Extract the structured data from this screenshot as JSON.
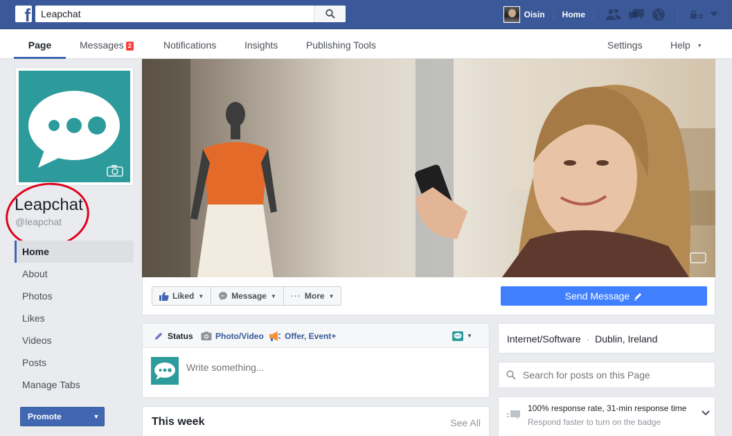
{
  "topbar": {
    "logo_glyph": "f",
    "search_value": "Leapchat",
    "user_name": "Oisin",
    "home_label": "Home",
    "icons": [
      "friends-icon",
      "messages-icon",
      "globe-icon",
      "lock-icon",
      "caret-down-icon"
    ]
  },
  "pagenav": {
    "tabs": [
      {
        "label": "Page",
        "active": true
      },
      {
        "label": "Messages",
        "badge": "2"
      },
      {
        "label": "Notifications"
      },
      {
        "label": "Insights"
      },
      {
        "label": "Publishing Tools"
      }
    ],
    "settings_label": "Settings",
    "help_label": "Help",
    "help_caret": "▼"
  },
  "page": {
    "name": "Leapchat",
    "handle": "@leapchat",
    "brand_color": "#2d9b9b"
  },
  "sidenav": {
    "items": [
      "Home",
      "About",
      "Photos",
      "Likes",
      "Videos",
      "Posts",
      "Manage Tabs"
    ],
    "active": "Home"
  },
  "promote": {
    "label": "Promote",
    "caret": "▼"
  },
  "actions": {
    "liked": "Liked",
    "message": "Message",
    "more": "More",
    "more_glyph": "···",
    "caret": "▼",
    "send_message": "Send Message"
  },
  "composer": {
    "status": "Status",
    "photo_video": "Photo/Video",
    "offer_event": "Offer, Event+",
    "placeholder": "Write something...",
    "caret": "▼"
  },
  "this_week": {
    "title": "This week",
    "see_all": "See All"
  },
  "info": {
    "category": "Internet/Software",
    "separator": "·",
    "location": "Dublin, Ireland"
  },
  "page_search": {
    "placeholder": "Search for posts on this Page"
  },
  "response": {
    "title": "100% response rate, 31-min response time",
    "subtitle": "Respond faster to turn on the badge"
  },
  "colors": {
    "facebook_blue": "#3b5998",
    "button_blue": "#4267b2",
    "send_blue": "#4080ff",
    "annotation_red": "#e0001b"
  }
}
